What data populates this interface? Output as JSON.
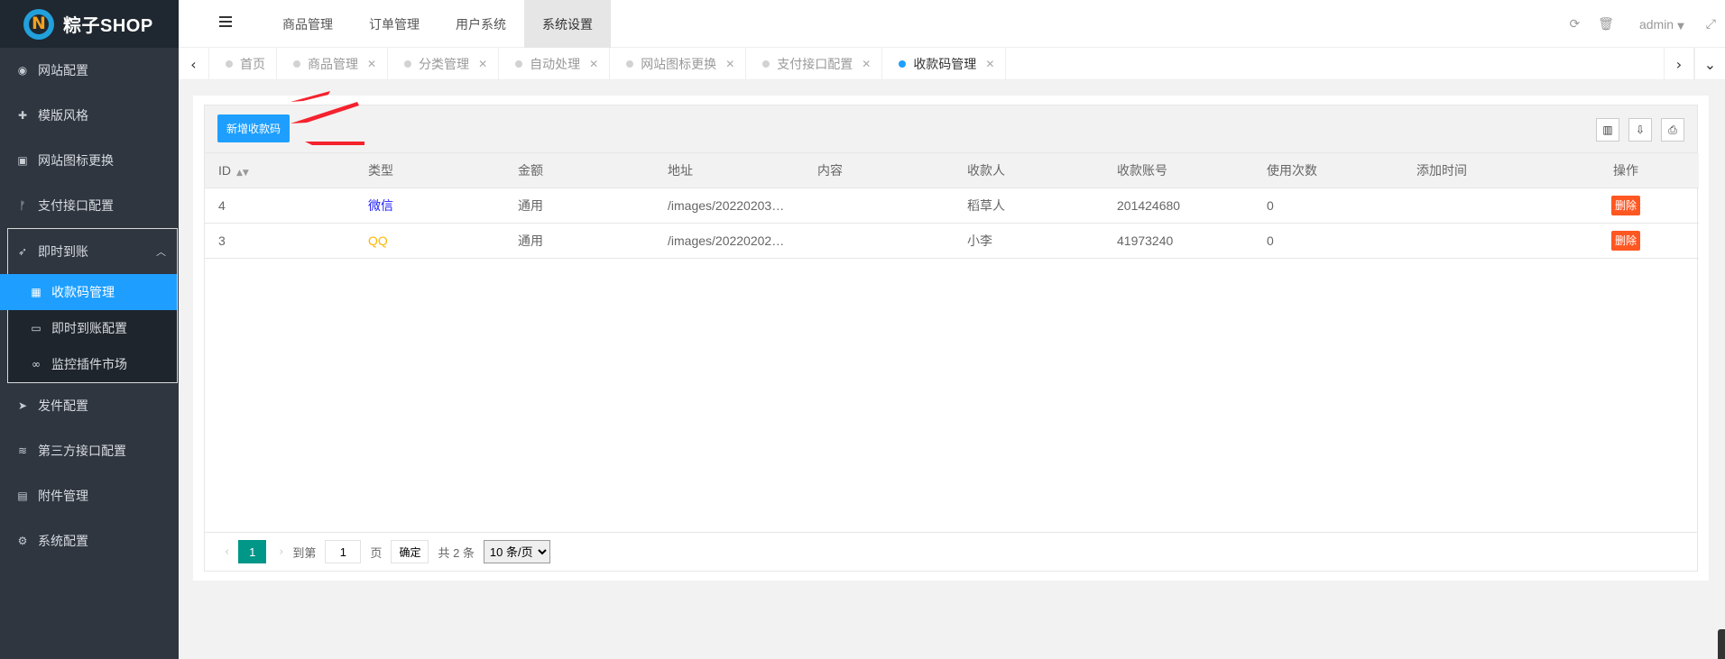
{
  "brand": {
    "name": "粽子SHOP"
  },
  "sidebar": {
    "items": [
      {
        "label": "网站配置",
        "icon": "target-icon"
      },
      {
        "label": "模版风格",
        "icon": "puzzle-icon"
      },
      {
        "label": "网站图标更换",
        "icon": "image-icon"
      },
      {
        "label": "支付接口配置",
        "icon": "branch-icon"
      }
    ],
    "group": {
      "label": "即时到账",
      "icon": "rocket-icon",
      "children": [
        {
          "label": "收款码管理",
          "icon": "qrcode-icon",
          "active": true
        },
        {
          "label": "即时到账配置",
          "icon": "laptop-icon"
        },
        {
          "label": "监控插件市场",
          "icon": "link-icon"
        }
      ]
    },
    "items_after": [
      {
        "label": "发件配置",
        "icon": "send-icon"
      },
      {
        "label": "第三方接口配置",
        "icon": "wifi-icon"
      },
      {
        "label": "附件管理",
        "icon": "file-icon"
      },
      {
        "label": "系统配置",
        "icon": "gear-icon"
      }
    ]
  },
  "topnav": [
    "商品管理",
    "订单管理",
    "用户系统",
    "系统设置"
  ],
  "topnav_active": "系统设置",
  "header": {
    "user": "admin"
  },
  "tabs": [
    {
      "label": "首页",
      "closable": false
    },
    {
      "label": "商品管理",
      "closable": true
    },
    {
      "label": "分类管理",
      "closable": true
    },
    {
      "label": "自动处理",
      "closable": true
    },
    {
      "label": "网站图标更换",
      "closable": true
    },
    {
      "label": "支付接口配置",
      "closable": true
    },
    {
      "label": "收款码管理",
      "closable": true,
      "active": true
    }
  ],
  "toolbar": {
    "add_label": "新增收款码"
  },
  "table": {
    "columns": [
      "ID",
      "类型",
      "金额",
      "地址",
      "内容",
      "收款人",
      "收款账号",
      "使用次数",
      "添加时间",
      "操作"
    ],
    "rows": [
      {
        "id": "4",
        "type": "微信",
        "amount": "通用",
        "address": "/images/20220203…",
        "content": "",
        "payee": "稻草人",
        "account": "201424680",
        "uses": "0",
        "added": "",
        "action": "删除"
      },
      {
        "id": "3",
        "type": "QQ",
        "amount": "通用",
        "address": "/images/20220202…",
        "content": "",
        "payee": "小李",
        "account": "41973240",
        "uses": "0",
        "added": "",
        "action": "删除"
      }
    ]
  },
  "pager": {
    "current": "1",
    "goto_label": "到第",
    "goto_value": "1",
    "page_label": "页",
    "confirm_label": "确定",
    "total_label": "共 2 条",
    "per_page": "10 条/页"
  },
  "colors": {
    "primary": "#1e9fff",
    "danger": "#ff5722",
    "pager_active": "#009688",
    "sidebar_bg": "#2f3640",
    "wechat": "#1e1eff",
    "qq": "#ffb800"
  }
}
